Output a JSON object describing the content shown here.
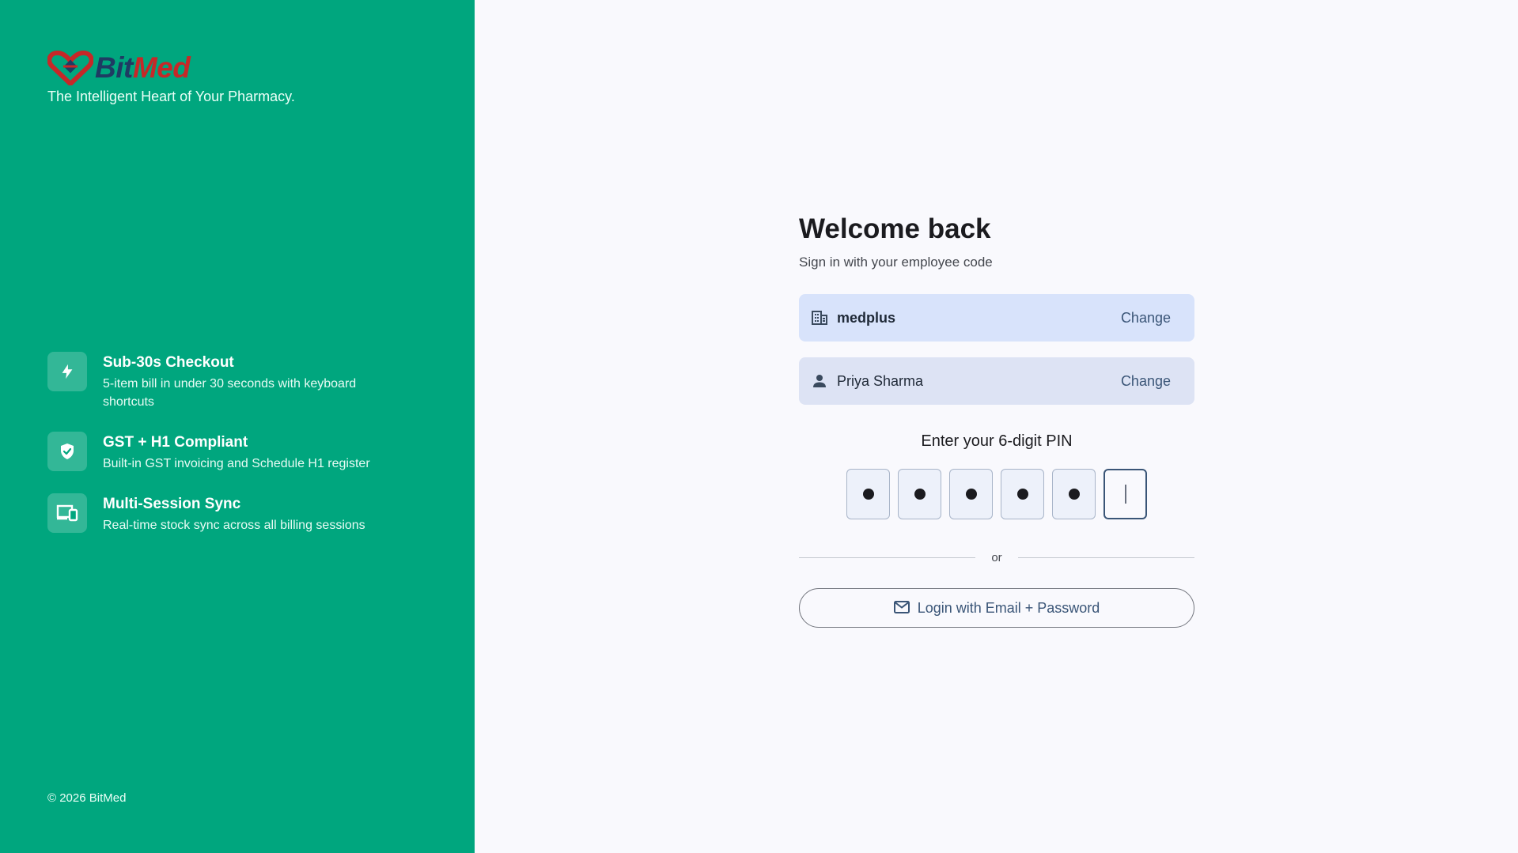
{
  "brand": {
    "name_part1": "Bit",
    "name_part2": "Med",
    "tagline": "The Intelligent Heart of Your Pharmacy.",
    "colors": {
      "panel": "#00a67e",
      "logo_red": "#c62828",
      "logo_navy": "#1f3b63"
    }
  },
  "features": [
    {
      "icon": "lightning-icon",
      "title": "Sub-30s Checkout",
      "description": "5-item bill in under 30 seconds with keyboard shortcuts"
    },
    {
      "icon": "shield-check-icon",
      "title": "GST + H1 Compliant",
      "description": "Built-in GST invoicing and Schedule H1 register"
    },
    {
      "icon": "devices-icon",
      "title": "Multi-Session Sync",
      "description": "Real-time stock sync across all billing sessions"
    }
  ],
  "copyright": "© 2026 BitMed",
  "login": {
    "title": "Welcome back",
    "subtitle": "Sign in with your employee code",
    "organization": {
      "icon": "building-icon",
      "name": "medplus",
      "change_label": "Change"
    },
    "user": {
      "icon": "person-icon",
      "name": "Priya Sharma",
      "change_label": "Change"
    },
    "pin_label": "Enter your 6-digit PIN",
    "pin_filled": 5,
    "pin_length": 6,
    "divider_text": "or",
    "email_button": {
      "icon": "mail-icon",
      "label": "Login with Email + Password"
    }
  }
}
